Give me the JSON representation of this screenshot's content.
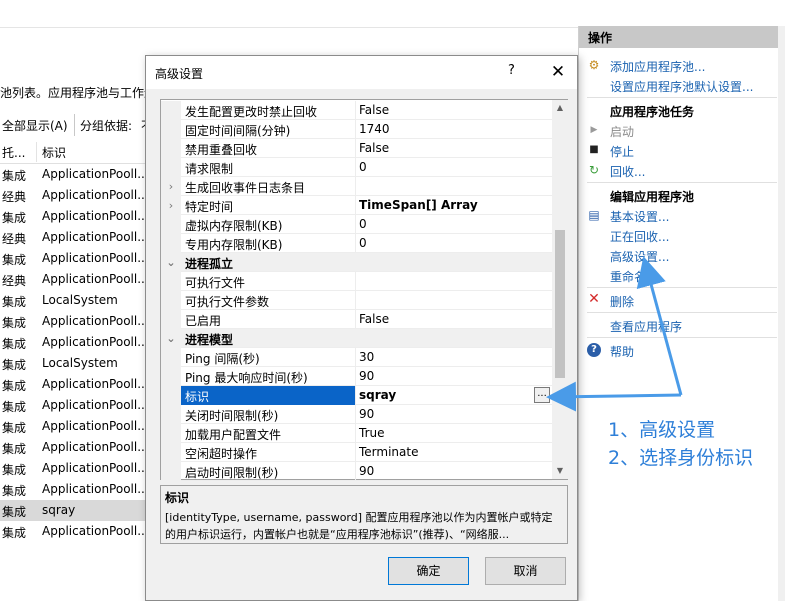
{
  "background": {
    "description_text": "池列表。应用程序池与工作进",
    "toolbar": {
      "show_all": "全部显示(A)",
      "group_by": "分组依据:",
      "group_value": "不"
    },
    "columns": [
      "托...",
      "标识"
    ],
    "rows": [
      {
        "mode": "集成",
        "identity": "ApplicationPooll..."
      },
      {
        "mode": "经典",
        "identity": "ApplicationPooll..."
      },
      {
        "mode": "集成",
        "identity": "ApplicationPooll..."
      },
      {
        "mode": "经典",
        "identity": "ApplicationPooll..."
      },
      {
        "mode": "集成",
        "identity": "ApplicationPooll..."
      },
      {
        "mode": "经典",
        "identity": "ApplicationPooll..."
      },
      {
        "mode": "集成",
        "identity": "LocalSystem"
      },
      {
        "mode": "集成",
        "identity": "ApplicationPooll..."
      },
      {
        "mode": "集成",
        "identity": "ApplicationPooll..."
      },
      {
        "mode": "集成",
        "identity": "LocalSystem"
      },
      {
        "mode": "集成",
        "identity": "ApplicationPooll..."
      },
      {
        "mode": "集成",
        "identity": "ApplicationPooll..."
      },
      {
        "mode": "集成",
        "identity": "ApplicationPooll..."
      },
      {
        "mode": "集成",
        "identity": "ApplicationPooll..."
      },
      {
        "mode": "集成",
        "identity": "ApplicationPooll..."
      },
      {
        "mode": "集成",
        "identity": "ApplicationPooll..."
      },
      {
        "mode": "集成",
        "identity": "sqray"
      },
      {
        "mode": "集成",
        "identity": "ApplicationPooll..."
      }
    ]
  },
  "actions": {
    "header": "操作",
    "add_pool": "添加应用程序池...",
    "set_defaults": "设置应用程序池默认设置...",
    "tasks_title": "应用程序池任务",
    "start": "启动",
    "stop": "停止",
    "recycle": "回收...",
    "edit_title": "编辑应用程序池",
    "basic_settings": "基本设置...",
    "recycling": "正在回收...",
    "advanced_settings": "高级设置...",
    "rename": "重命名",
    "delete": "删除",
    "view_apps": "查看应用程序",
    "help": "帮助"
  },
  "dialog": {
    "title": "高级设置",
    "help": "?",
    "close": "✕",
    "properties": [
      {
        "name": "发生配置更改时禁止回收",
        "value": "False"
      },
      {
        "name": "固定时间间隔(分钟)",
        "value": "1740"
      },
      {
        "name": "禁用重叠回收",
        "value": "False"
      },
      {
        "name": "请求限制",
        "value": "0"
      },
      {
        "name": "生成回收事件日志条目",
        "value": ""
      },
      {
        "name": "特定时间",
        "value": "TimeSpan[] Array"
      },
      {
        "name": "虚拟内存限制(KB)",
        "value": "0"
      },
      {
        "name": "专用内存限制(KB)",
        "value": "0"
      },
      {
        "name": "进程孤立",
        "value": ""
      },
      {
        "name": "可执行文件",
        "value": ""
      },
      {
        "name": "可执行文件参数",
        "value": ""
      },
      {
        "name": "已启用",
        "value": "False"
      },
      {
        "name": "进程模型",
        "value": ""
      },
      {
        "name": "Ping 间隔(秒)",
        "value": "30"
      },
      {
        "name": "Ping 最大响应时间(秒)",
        "value": "90"
      },
      {
        "name": "标识",
        "value": "sqray"
      },
      {
        "name": "关闭时间限制(秒)",
        "value": "90"
      },
      {
        "name": "加载用户配置文件",
        "value": "True"
      },
      {
        "name": "空闲超时操作",
        "value": "Terminate"
      },
      {
        "name": "启动时间限制(秒)",
        "value": "90"
      }
    ],
    "ellipsis": "...",
    "desc_title": "标识",
    "desc_text": "[identityType, username, password] 配置应用程序池以作为内置帐户或特定的用户标识运行，内置帐户也就是“应用程序池标识”(推荐)、“网络服...",
    "ok": "确定",
    "cancel": "取消"
  },
  "annotation": {
    "line1": "1、高级设置",
    "line2": "2、选择身份标识",
    "color": "#2e7fd8"
  }
}
